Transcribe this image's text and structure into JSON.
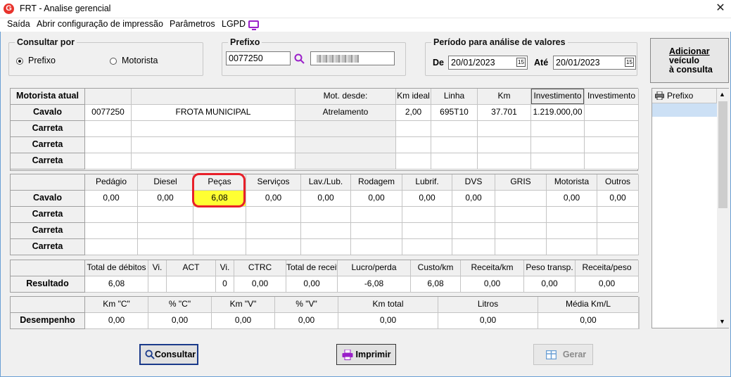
{
  "window": {
    "title": "FRT - Analise gerencial",
    "app_icon": "G"
  },
  "menu": [
    "Saída",
    "Abrir configuração de impressão",
    "Parâmetros",
    "LGPD"
  ],
  "consultar_por": {
    "legend": "Consultar por",
    "options": [
      "Prefixo",
      "Motorista"
    ],
    "selected": "Prefixo"
  },
  "prefixo": {
    "legend": "Prefixo",
    "value": "0077250"
  },
  "periodo": {
    "legend": "Período para análise de valores",
    "de_label": "De",
    "de_value": "20/01/2023",
    "ate_label": "Até",
    "ate_value": "20/01/2023",
    "cal_glyph": "15"
  },
  "add_button": {
    "line1": "Adicionar",
    "line2": "veículo",
    "line3": "à consulta"
  },
  "side_list": {
    "header": "Prefixo"
  },
  "vehicles": {
    "headers": [
      "Motorista atual",
      "",
      "",
      "Mot. desde:",
      "Km ideal",
      "Linha",
      "Km",
      "Investimento",
      "Investimento"
    ],
    "rows": [
      {
        "label": "Cavalo",
        "cells": [
          "0077250",
          "FROTA MUNICIPAL",
          "Atrelamento",
          "2,00",
          "695T10",
          "37.701",
          "1.219.000,00",
          ""
        ]
      },
      {
        "label": "Carreta",
        "cells": [
          "",
          "",
          "",
          "",
          "",
          "",
          "",
          ""
        ]
      },
      {
        "label": "Carreta",
        "cells": [
          "",
          "",
          "",
          "",
          "",
          "",
          "",
          ""
        ]
      },
      {
        "label": "Carreta",
        "cells": [
          "",
          "",
          "",
          "",
          "",
          "",
          "",
          ""
        ]
      }
    ]
  },
  "costs": {
    "headers": [
      "Pedágio",
      "Diesel",
      "Peças",
      "Serviços",
      "Lav./Lub.",
      "Rodagem",
      "Lubrif.",
      "DVS",
      "GRIS",
      "Motorista",
      "Outros"
    ],
    "rows": [
      {
        "label": "Cavalo",
        "cells": [
          "0,00",
          "0,00",
          "6,08",
          "0,00",
          "0,00",
          "0,00",
          "0,00",
          "0,00",
          "",
          "0,00",
          "0,00"
        ]
      },
      {
        "label": "Carreta",
        "cells": [
          "",
          "",
          "",
          "",
          "",
          "",
          "",
          "",
          "",
          "",
          ""
        ]
      },
      {
        "label": "Carreta",
        "cells": [
          "",
          "",
          "",
          "",
          "",
          "",
          "",
          "",
          "",
          "",
          ""
        ]
      },
      {
        "label": "Carreta",
        "cells": [
          "",
          "",
          "",
          "",
          "",
          "",
          "",
          "",
          "",
          "",
          ""
        ]
      }
    ],
    "highlight_color": "#ffff33"
  },
  "results": {
    "headers": [
      "Total de débitos",
      "Vi.",
      "ACT",
      "Vi.",
      "CTRC",
      "Total de receitas",
      "Lucro/perda",
      "Custo/km",
      "Receita/km",
      "Peso transp.",
      "Receita/peso"
    ],
    "label": "Resultado",
    "cells": [
      "6,08",
      "",
      "",
      "0",
      "0,00",
      "0,00",
      "-6,08",
      "6,08",
      "0,00",
      "0,00",
      "0,00"
    ]
  },
  "performance": {
    "headers": [
      "Km \"C\"",
      "% \"C\"",
      "Km \"V\"",
      "% \"V\"",
      "Km total",
      "Litros",
      "Média Km/L"
    ],
    "label": "Desempenho",
    "cells": [
      "0,00",
      "0,00",
      "0,00",
      "0,00",
      "0,00",
      "0,00",
      "0,00"
    ]
  },
  "buttons": {
    "consultar": "Consultar",
    "imprimir": "Imprimir",
    "gerar": "Gerar"
  },
  "colors": {
    "accent": "#9a1fc9",
    "window_border": "#6a9fd4",
    "highlight_ring": "#e8202a",
    "brand": "#e8332c"
  }
}
